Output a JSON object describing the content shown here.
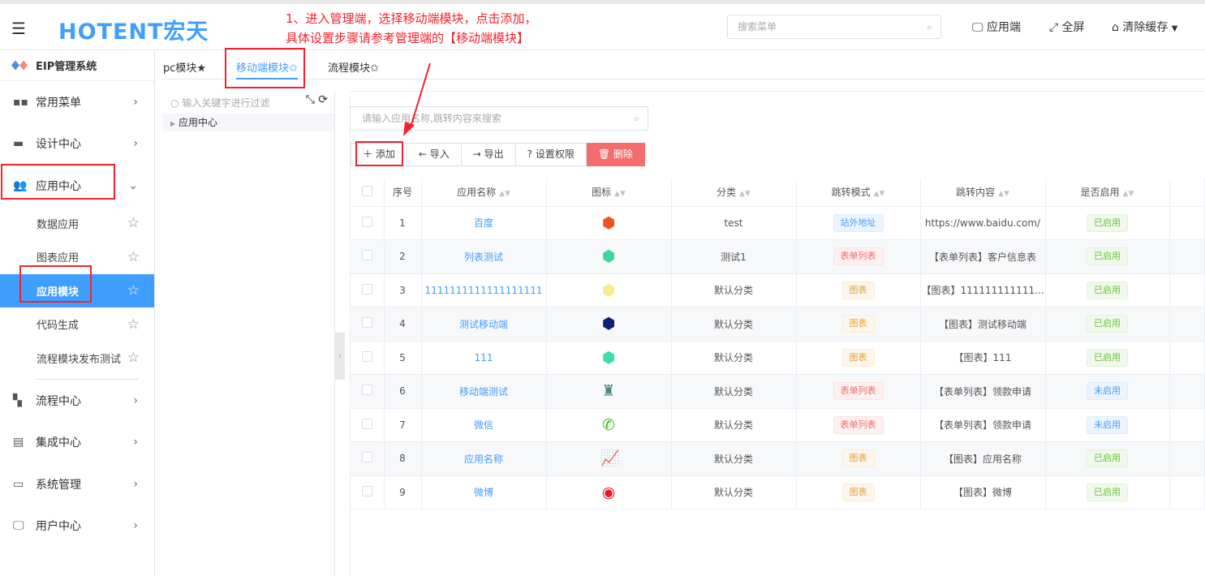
{
  "header": {
    "logo": "HOTENT宏天",
    "annotation_line1": "1、进入管理端，选择移动端模块，点击添加，",
    "annotation_line2": "具体设置步骤请参考管理端的【移动端模块】",
    "search_placeholder": "搜索菜单",
    "app_end": "应用端",
    "fullscreen": "全屏",
    "clear_cache": "清除缓存"
  },
  "sidebar": {
    "brand": "EIP管理系统",
    "items": [
      {
        "label": "常用菜单",
        "icon": "grid-icon"
      },
      {
        "label": "设计中心",
        "icon": "keyboard-icon"
      },
      {
        "label": "应用中心",
        "icon": "users-icon"
      }
    ],
    "sub_items": [
      {
        "label": "数据应用"
      },
      {
        "label": "图表应用"
      },
      {
        "label": "应用模块"
      },
      {
        "label": "代码生成"
      },
      {
        "label": "流程模块发布测试"
      }
    ],
    "items2": [
      {
        "label": "流程中心",
        "icon": "apps-icon"
      },
      {
        "label": "集成中心",
        "icon": "integration-icon"
      },
      {
        "label": "系统管理",
        "icon": "monitor-chart-icon"
      },
      {
        "label": "用户中心",
        "icon": "monitor-icon"
      }
    ]
  },
  "tabs": [
    {
      "label": "pc模块★"
    },
    {
      "label": "移动端模块✩"
    },
    {
      "label": "流程模块✩"
    }
  ],
  "tree": {
    "filter_placeholder": "输入关键字进行过滤",
    "root": "应用中心"
  },
  "search": {
    "placeholder": "请输入应用名称,跳转内容来搜索"
  },
  "toolbar": {
    "add": "添加",
    "import": "导入",
    "export": "导出",
    "permission": "设置权限",
    "delete": "删除"
  },
  "table": {
    "headers": [
      "序号",
      "应用名称",
      "图标",
      "分类",
      "跳转模式",
      "跳转内容",
      "是否启用"
    ],
    "rows": [
      {
        "no": "1",
        "name": "百度",
        "icon": "cube-icon",
        "icon_color": "#f0521d",
        "category": "test",
        "mode": "站外地址",
        "mode_color": "blue",
        "content": "https://www.baidu.com/",
        "status": "已启用",
        "status_color": "green"
      },
      {
        "no": "2",
        "name": "列表测试",
        "icon": "cube-icon",
        "icon_color": "#3ed6a0",
        "category": "测试1",
        "mode": "表单列表",
        "mode_color": "red",
        "content": "【表单列表】客户信息表",
        "status": "已启用",
        "status_color": "green"
      },
      {
        "no": "3",
        "name": "1111111111111111111",
        "icon": "cube-icon",
        "icon_color": "#f7ec8a",
        "category": "默认分类",
        "mode": "图表",
        "mode_color": "orange",
        "content": "【图表】111111111111...",
        "status": "已启用",
        "status_color": "green"
      },
      {
        "no": "4",
        "name": "测试移动端",
        "icon": "cube-icon",
        "icon_color": "#0d1f7a",
        "category": "默认分类",
        "mode": "图表",
        "mode_color": "orange",
        "content": "【图表】测试移动端",
        "status": "已启用",
        "status_color": "green"
      },
      {
        "no": "5",
        "name": "111",
        "icon": "cube-icon",
        "icon_color": "#3ee0a8",
        "category": "默认分类",
        "mode": "图表",
        "mode_color": "orange",
        "content": "【图表】111",
        "status": "已启用",
        "status_color": "green"
      },
      {
        "no": "6",
        "name": "移动端测试",
        "icon": "stamp-icon",
        "icon_color": "#4a8a7a",
        "category": "默认分类",
        "mode": "表单列表",
        "mode_color": "red",
        "content": "【表单列表】领款申请",
        "status": "未启用",
        "status_color": "blue"
      },
      {
        "no": "7",
        "name": "微信",
        "icon": "wechat-icon",
        "icon_color": "#2dc100",
        "category": "默认分类",
        "mode": "表单列表",
        "mode_color": "red",
        "content": "【表单列表】领款申请",
        "status": "未启用",
        "status_color": "blue"
      },
      {
        "no": "8",
        "name": "应用名称",
        "icon": "line-chart-icon",
        "icon_color": "#e0301e",
        "category": "默认分类",
        "mode": "图表",
        "mode_color": "orange",
        "content": "【图表】应用名称",
        "status": "已启用",
        "status_color": "green"
      },
      {
        "no": "9",
        "name": "微博",
        "icon": "weibo-icon",
        "icon_color": "#e6162d",
        "category": "默认分类",
        "mode": "图表",
        "mode_color": "orange",
        "content": "【图表】微博",
        "status": "已启用",
        "status_color": "green"
      }
    ]
  },
  "colors": {
    "accent": "#409eff",
    "annotation": "#f5222d",
    "danger": "#f56c6c"
  }
}
